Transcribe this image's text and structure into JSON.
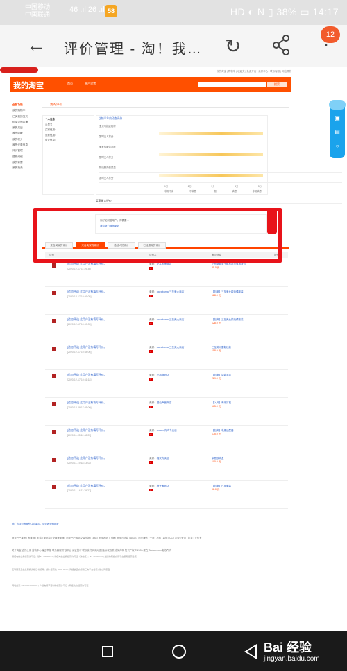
{
  "status_bar": {
    "carrier1": "中国移动",
    "carrier2": "中国联通",
    "signal_text": "46 .ıl 26 .ıl",
    "app_badge": "58",
    "right_text": "HD ◐ N ▯ 38% ▭ 14:17"
  },
  "browser": {
    "title": "评价管理 - 淘！我…",
    "tab_count": "12"
  },
  "taobao": {
    "top_nav": "我的淘宝 | 购物车 | 收藏夹 | 免费开店 | 卖家中心 | 联系客服 | 网站导航",
    "logo": "我的淘宝",
    "nav": [
      "首页",
      "账户设置"
    ],
    "search_btn": "搜索",
    "left_menu": [
      "全部功能",
      "我的购物车",
      "已买到的宝贝",
      "购买过的店铺",
      "我的足迹",
      "我的收藏",
      "我的积分",
      "我的优惠信息",
      "评价管理",
      "退款维权",
      "我的彩票",
      "我的拍卖"
    ],
    "main_tab": "我的评价",
    "info_title": "个人信息",
    "info_lines": [
      "会员名：",
      "买家信用：",
      "卖家信用：",
      "认证信息："
    ],
    "rating_title": "店铺半年内动态评分",
    "rating_rows": [
      "宝贝与描述相符",
      "暂时无人打分",
      "卖家的服务态度",
      "暂时无人打分",
      "物流服务的质量",
      "暂时无人打分"
    ],
    "scale": [
      "1分",
      "2分",
      "3分",
      "4分",
      "5分"
    ],
    "scale_sub": [
      "非常不满",
      "不满意",
      "一般",
      "满意",
      "非常满意"
    ],
    "feedback_title": "买家留言评价",
    "feedback_text": "你好如何差用户，你需要…",
    "feedback_link": "我会努力做得更好",
    "tabs": [
      "来自买家的评价",
      "来自卖家的评价",
      "给他人的评价",
      "已经删除的评价"
    ],
    "col_headers": [
      "评价",
      "评价人",
      "宝贝信息",
      "操作"
    ],
    "rows": [
      {
        "text": "[追加评论] 此用户没有填写评价。",
        "date": "[2020-12-17 11:29:36]",
        "seller": "卖家：",
        "seller_name": "北斗天地商店",
        "item": "正品新款男士帆布水洗双肩背包",
        "price": "85.0 元"
      },
      {
        "text": "[追加评论] 此用户没有填写评价。",
        "date": "[2020-12-17 10:59:05]",
        "seller": "卖家：",
        "seller_name": "oaeabama 三至美大商店",
        "item": "【包邮】三至美女款玩偶套装",
        "price": "128.0 元"
      },
      {
        "text": "[追加评论] 此用户没有填写评价。",
        "date": "[2020-12-17 10:59:05]",
        "seller": "卖家：",
        "seller_name": "oaeabama 三至美大商店",
        "item": "【包邮】三至美女款玩偶套装",
        "price": "128.0 元"
      },
      {
        "text": "[追加评论] 此用户没有填写评价。",
        "date": "[2020-12-17 10:54:06]",
        "seller": "卖家：",
        "seller_name": "oaeabama 三至美大商店",
        "item": "三至美儿童鞋秋款",
        "price": "158.0 元"
      },
      {
        "text": "[追加评论] 此用户没有填写评价。",
        "date": "[2020-12-17 10:51:18]",
        "seller": "卖家：",
        "seller_name": "小城数码店",
        "item": "【包邮】智能手表",
        "price": "229.0 元"
      },
      {
        "text": "[追加评论] 此用户没有填写评价。",
        "date": "[2020-12-09 17:55:00]",
        "seller": "卖家：",
        "seller_name": "晨山声音商店",
        "item": "【入网】有线耳机",
        "price": "165.0 元"
      },
      {
        "text": "[追加评论] 此用户没有填写评价。",
        "date": "[2020-11-28 12:48:23]",
        "seller": "卖家：",
        "seller_name": "orcam 有声专卖店",
        "item": "【包邮】电源适配器",
        "price": "175.0 元"
      },
      {
        "text": "[追加评论] 此用户没有填写评价。",
        "date": "[2020-11-19 18:43:02]",
        "seller": "卖家：",
        "seller_name": "福安专卖店",
        "item": "家居收纳盒",
        "price": "100.0 元"
      },
      {
        "text": "[追加评论] 此用户没有填写评价。",
        "date": "[2020-11-14 11:29:27]",
        "seller": "卖家：",
        "seller_name": "橙子家居店",
        "item": "【包邮】日用套装",
        "price": "98.0 元"
      }
    ],
    "footer_note": "对广告评价有哪些注意事项。请查看说明网址",
    "footer_links": "阿里巴巴集团 | 淘宝网 | 天猫 | 聚划算 | 全球速卖通 | 阿里巴巴国际交易市场 | 1688 | 阿里妈妈 | 飞猪 | 阿里云计算 | AliOS | 阿里通信 | 一淘 | 万网 | 高德 | UC | 友盟 | 虾米 | 钉钉 | 支付宝",
    "footer_about": "关于淘宝 合作伙伴 营销中心 廉正举报 联系客服 开放平台 诚征英才 联系我们 网站地图 隐私权政策 法律声明 知识产权 © 2003-现在 Taobao.com 版权所有",
    "footer_small1": "增值电信业务经营许可证：浙B2-20080224 | 增值电信业务经营许可证（跨地区）：B2-20150210 | 出版物网络交易平台服务经营备案",
    "footer_small2": "互联网药品信息服务资格证书编号：(浙)-经营性-2018-0016 | 网络食品交易第三方平台备案 | 浙公网安备",
    "footer_small3": "网址备案 33010002000078 | 广播电视节目制作经营许可证 | 网络文化经营许可证"
  },
  "watermark": {
    "main": "Bai 经验",
    "sub": "jingyan.baidu.com"
  },
  "colors": {
    "taobao_orange": "#ff5000",
    "annotation_red": "#e8131a",
    "link_blue": "#3366cc"
  }
}
